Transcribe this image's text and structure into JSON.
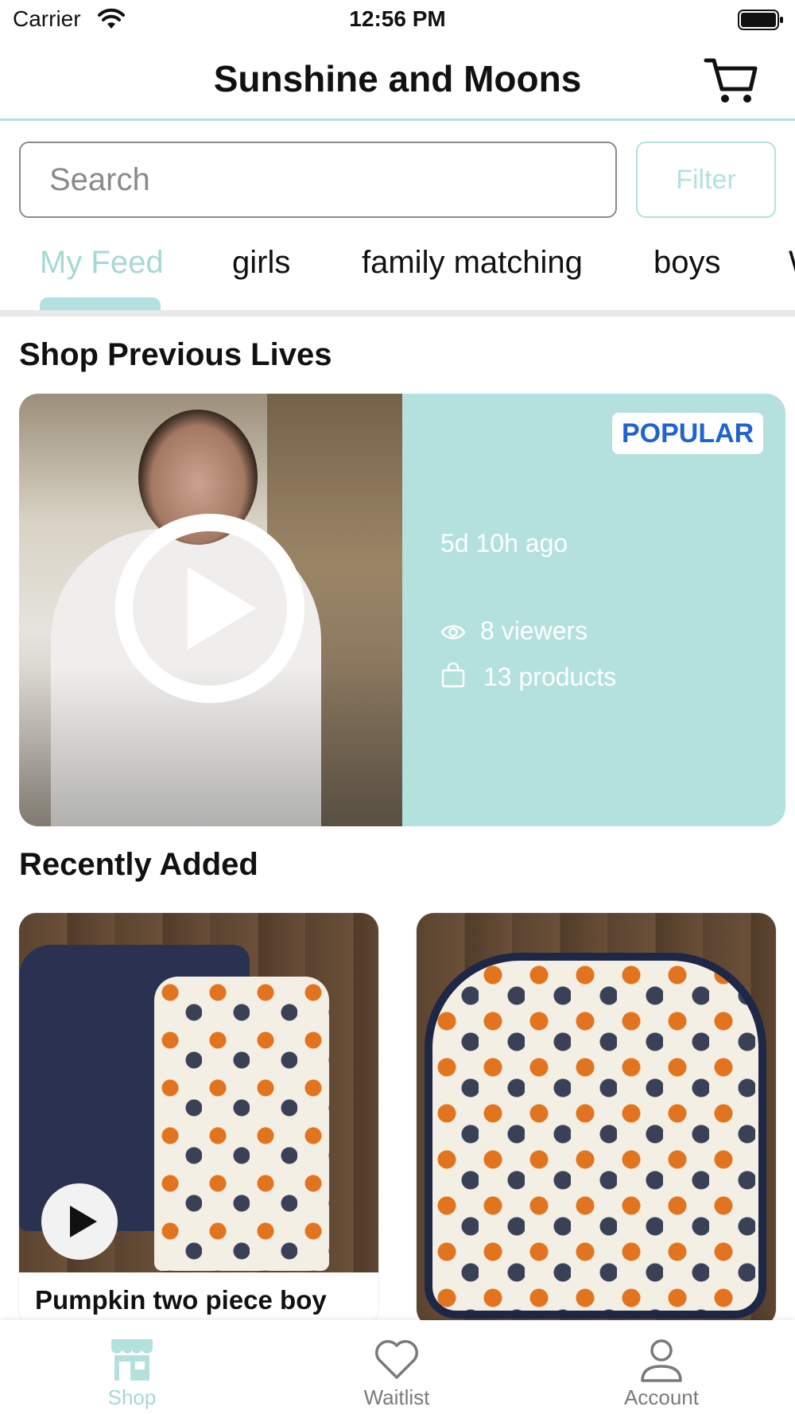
{
  "status_bar": {
    "carrier": "Carrier",
    "time": "12:56 PM"
  },
  "header": {
    "title": "Sunshine and Moons",
    "cart_icon": "cart-icon"
  },
  "search": {
    "placeholder": "Search",
    "filter_label": "Filter"
  },
  "tabs": [
    {
      "label": "My Feed",
      "active": true
    },
    {
      "label": "girls",
      "active": false
    },
    {
      "label": "family matching",
      "active": false
    },
    {
      "label": "boys",
      "active": false
    },
    {
      "label": "W",
      "active": false
    }
  ],
  "previous_lives": {
    "title": "Shop Previous Lives",
    "card": {
      "badge": "POPULAR",
      "time_ago": "5d 10h ago",
      "viewers": "8 viewers",
      "products": "13 products"
    }
  },
  "recently_added": {
    "title": "Recently Added",
    "products": [
      {
        "title": "Pumpkin two piece boy"
      },
      {
        "title": ""
      }
    ]
  },
  "bottom_nav": [
    {
      "label": "Shop",
      "icon": "shop-icon",
      "active": true
    },
    {
      "label": "Waitlist",
      "icon": "heart-icon",
      "active": false
    },
    {
      "label": "Account",
      "icon": "person-icon",
      "active": false
    }
  ],
  "colors": {
    "accent": "#b4e1de",
    "accent_text": "#a6d9d5",
    "badge_text": "#1f63d3"
  }
}
